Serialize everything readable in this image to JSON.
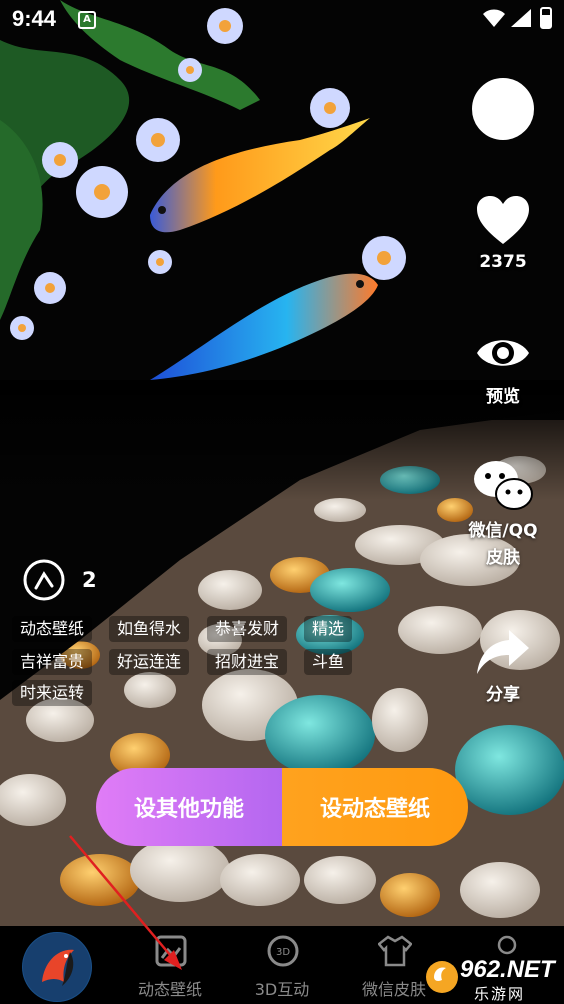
{
  "status_bar": {
    "time": "9:44",
    "badge": "A"
  },
  "side_actions": {
    "likes_count": "2375",
    "preview_label": "预览",
    "skin_label_line1": "微信/QQ",
    "skin_label_line2": "皮肤",
    "share_label": "分享"
  },
  "info": {
    "count": "2",
    "tags": [
      "动态壁纸",
      "如鱼得水",
      "恭喜发财",
      "精选",
      "吉祥富贵",
      "好运连连",
      "招财进宝",
      "斗鱼",
      "时来运转"
    ]
  },
  "buttons": {
    "other_features": "设其他功能",
    "set_live_wallpaper": "设动态壁纸"
  },
  "tabs": [
    {
      "label": "动态壁纸"
    },
    {
      "label": "3D互动"
    },
    {
      "label": "微信皮肤"
    }
  ],
  "watermark": {
    "text": "962.NET",
    "sub": "乐游网"
  },
  "colors": {
    "left_button": "#c46ff3",
    "right_button": "#ffa11a",
    "tab_label": "#8a8a8a",
    "arrow": "#e02020"
  }
}
